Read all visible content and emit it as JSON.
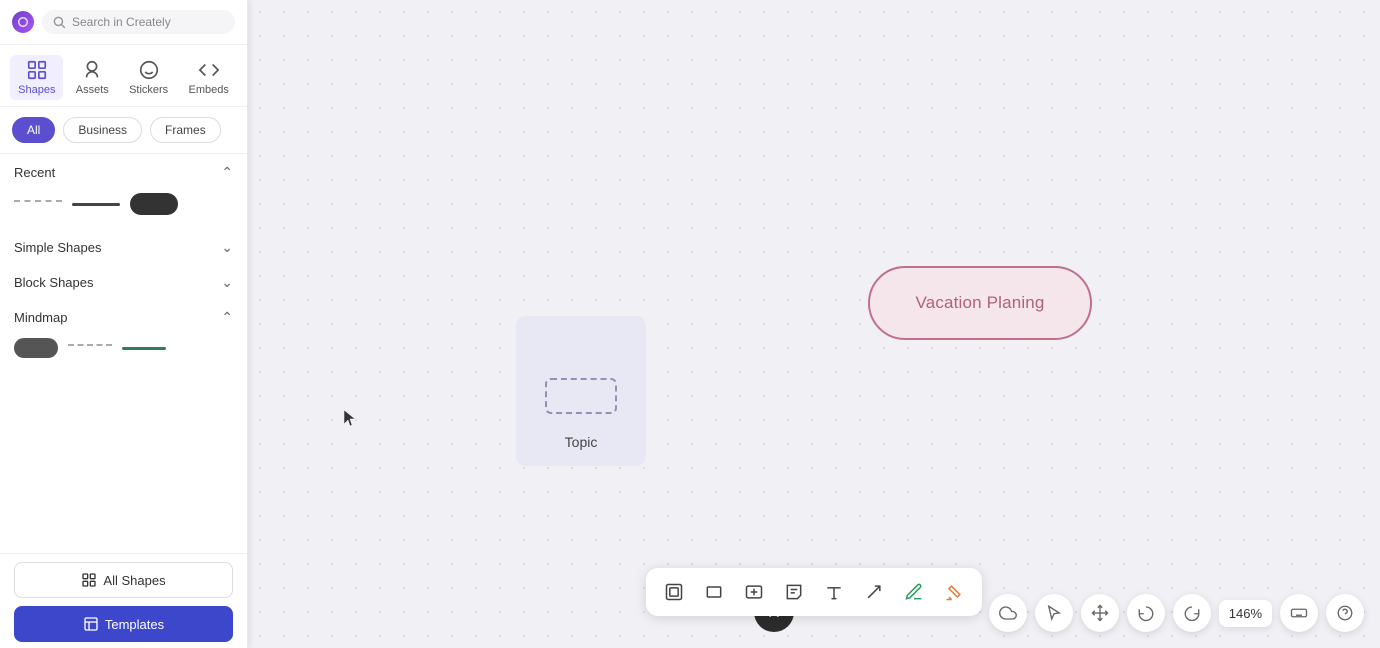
{
  "sidebar": {
    "search_placeholder": "Search in Creately",
    "nav_items": [
      {
        "id": "shapes",
        "label": "Shapes",
        "active": true
      },
      {
        "id": "assets",
        "label": "Assets",
        "active": false
      },
      {
        "id": "stickers",
        "label": "Stickers",
        "active": false
      },
      {
        "id": "embeds",
        "label": "Embeds",
        "active": false
      }
    ],
    "filters": [
      {
        "id": "all",
        "label": "All",
        "active": true
      },
      {
        "id": "business",
        "label": "Business",
        "active": false
      },
      {
        "id": "frames",
        "label": "Frames",
        "active": false
      }
    ],
    "sections": [
      {
        "id": "recent",
        "label": "Recent",
        "expanded": true
      },
      {
        "id": "simple_shapes",
        "label": "Simple Shapes",
        "expanded": false
      },
      {
        "id": "block_shapes",
        "label": "Block Shapes",
        "expanded": false
      },
      {
        "id": "mindmap",
        "label": "Mindmap",
        "expanded": true
      }
    ],
    "all_shapes_label": "All Shapes",
    "templates_label": "Templates"
  },
  "canvas": {
    "vacation_bubble_label": "Vacation Planing",
    "topic_label": "Topic",
    "zoom_level": "146%"
  },
  "toolbar": {
    "items": [
      {
        "id": "frame",
        "icon": "frame-icon"
      },
      {
        "id": "rectangle",
        "icon": "rectangle-icon"
      },
      {
        "id": "text-box",
        "icon": "textbox-icon"
      },
      {
        "id": "sticky-note",
        "icon": "stickynote-icon"
      },
      {
        "id": "text",
        "icon": "text-icon"
      },
      {
        "id": "arrow",
        "icon": "arrow-icon"
      },
      {
        "id": "pen",
        "icon": "pen-icon"
      },
      {
        "id": "highlighter",
        "icon": "highlighter-icon"
      }
    ],
    "close_label": "×"
  },
  "bottom_right": {
    "cloud_icon": "cloud-icon",
    "cursor_icon": "cursor-icon",
    "move_icon": "move-icon",
    "undo_icon": "undo-icon",
    "redo_icon": "redo-icon",
    "keyboard_icon": "keyboard-icon",
    "help_icon": "help-icon",
    "zoom": "146%"
  }
}
